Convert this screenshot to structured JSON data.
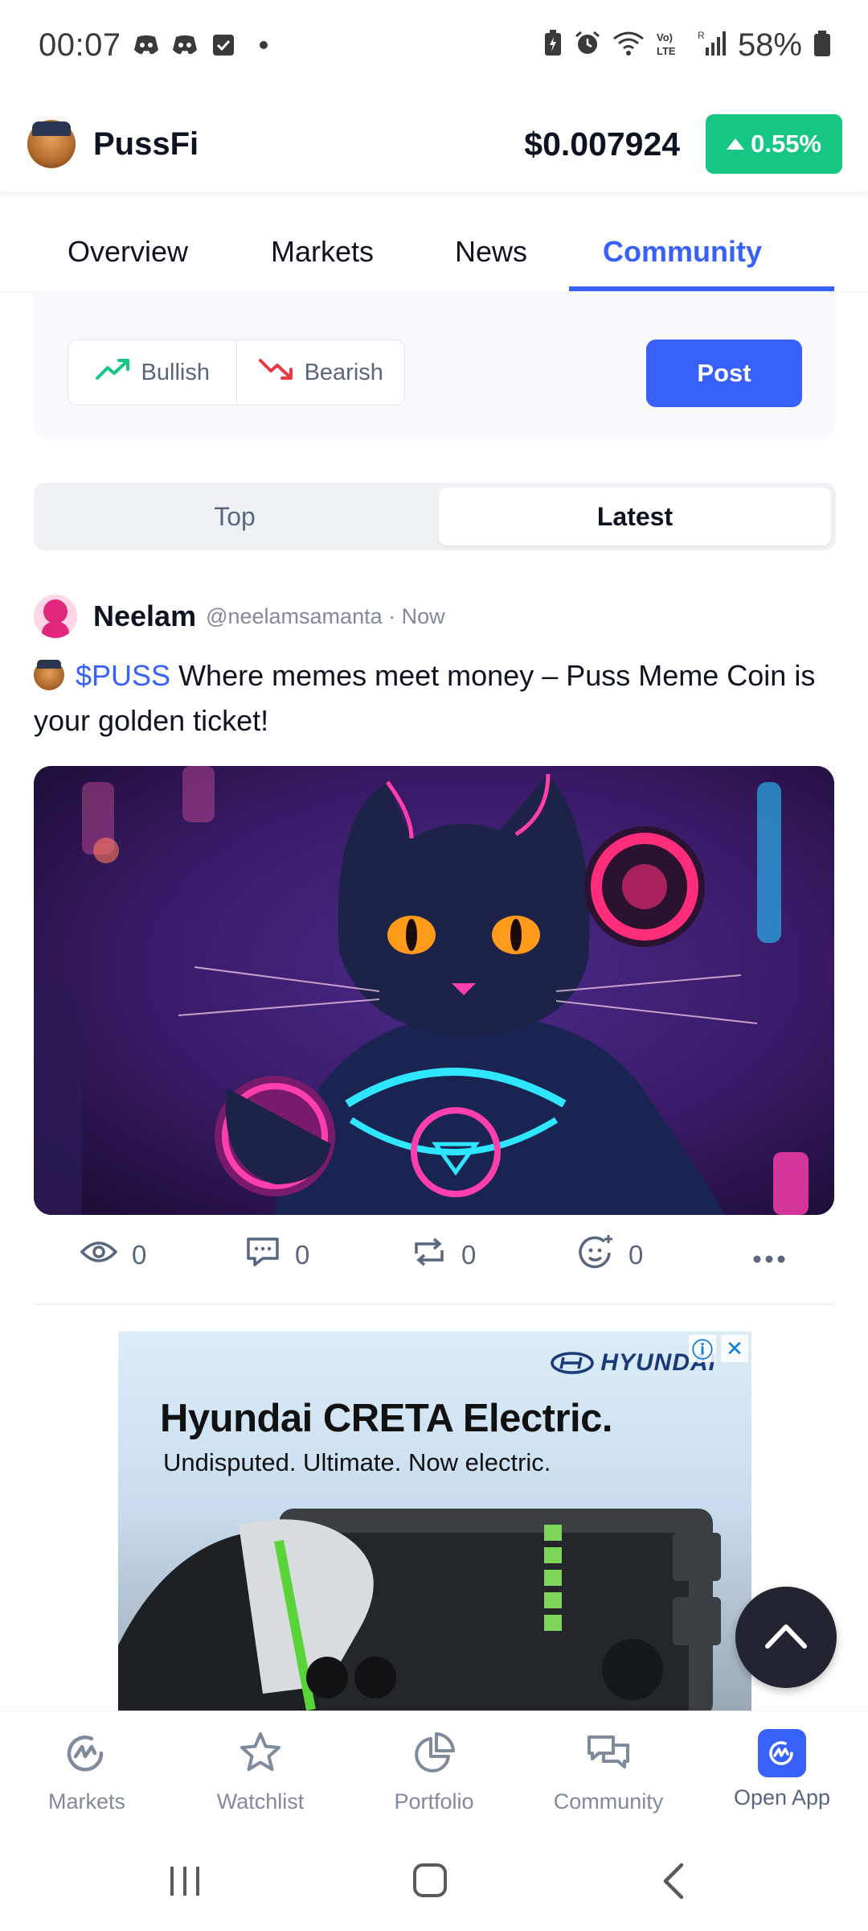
{
  "status_bar": {
    "time": "00:07",
    "battery": "58%",
    "notification_icons": [
      "discord-icon",
      "discord-icon",
      "checkbox-icon"
    ]
  },
  "header": {
    "app_name": "PussFi",
    "price": "$0.007924",
    "change": "0.55%",
    "change_color": "#16c784"
  },
  "tabs": [
    {
      "label": "Overview"
    },
    {
      "label": "Markets"
    },
    {
      "label": "News"
    },
    {
      "label": "Community",
      "active": true
    }
  ],
  "composer": {
    "bullish_label": "Bullish",
    "bearish_label": "Bearish",
    "post_label": "Post"
  },
  "feed_toggle": {
    "top_label": "Top",
    "latest_label": "Latest",
    "selected": "Latest"
  },
  "post": {
    "author": "Neelam",
    "handle": "@neelamsamanta · Now",
    "cashtag": "$PUSS",
    "text": " Where memes meet money – Puss Meme Coin is your golden ticket!",
    "views": "0",
    "comments": "0",
    "reposts": "0",
    "reactions": "0"
  },
  "ad": {
    "brand": "HYUNDAI",
    "headline": "Hyundai CRETA Electric.",
    "subline": "Undisputed. Ultimate. Now electric."
  },
  "bottom_nav": [
    {
      "label": "Markets"
    },
    {
      "label": "Watchlist"
    },
    {
      "label": "Portfolio"
    },
    {
      "label": "Community"
    },
    {
      "label": "Open App"
    }
  ],
  "colors": {
    "accent": "#3861fb",
    "positive": "#16c784",
    "negative": "#ea3943"
  }
}
